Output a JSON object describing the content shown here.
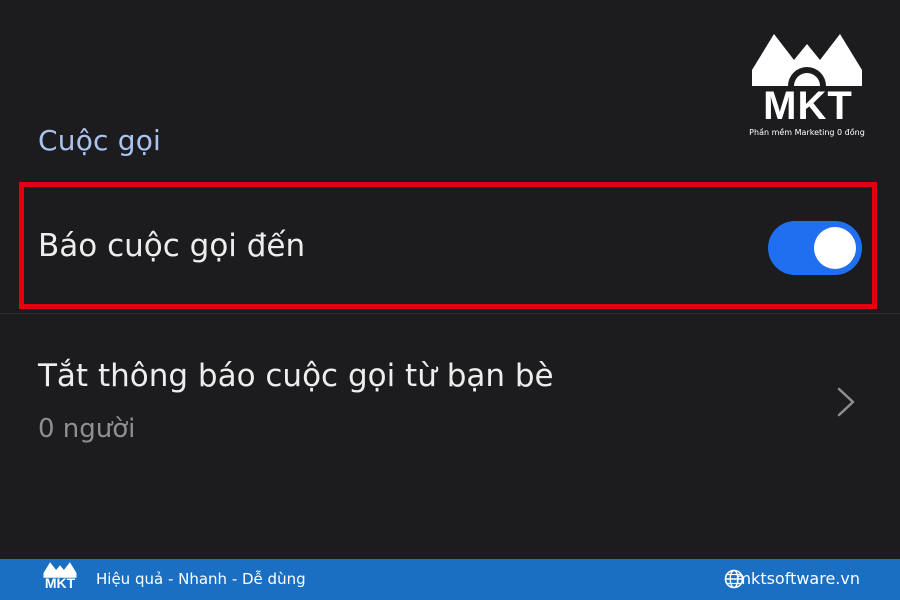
{
  "settings": {
    "section_title": "Cuộc gọi",
    "incoming_call_notification": {
      "label": "Báo cuộc gọi đến",
      "enabled": true
    },
    "mute_friend_calls": {
      "label": "Tắt thông báo cuộc gọi từ bạn bè",
      "count_text": "0 người"
    }
  },
  "watermark": {
    "brand": "MKT",
    "tagline": "Phần mềm Marketing 0 đồng"
  },
  "footer": {
    "slogan": "Hiệu quả - Nhanh - Dễ dùng",
    "website": "mktsoftware.vn"
  },
  "colors": {
    "accent_blue": "#1f6ff0",
    "highlight_red": "#e3000f",
    "section_title": "#a9c3ee",
    "footer_bg": "#1a6fc2"
  },
  "icons": {
    "chevron": "chevron-right-icon",
    "globe": "globe-icon"
  }
}
